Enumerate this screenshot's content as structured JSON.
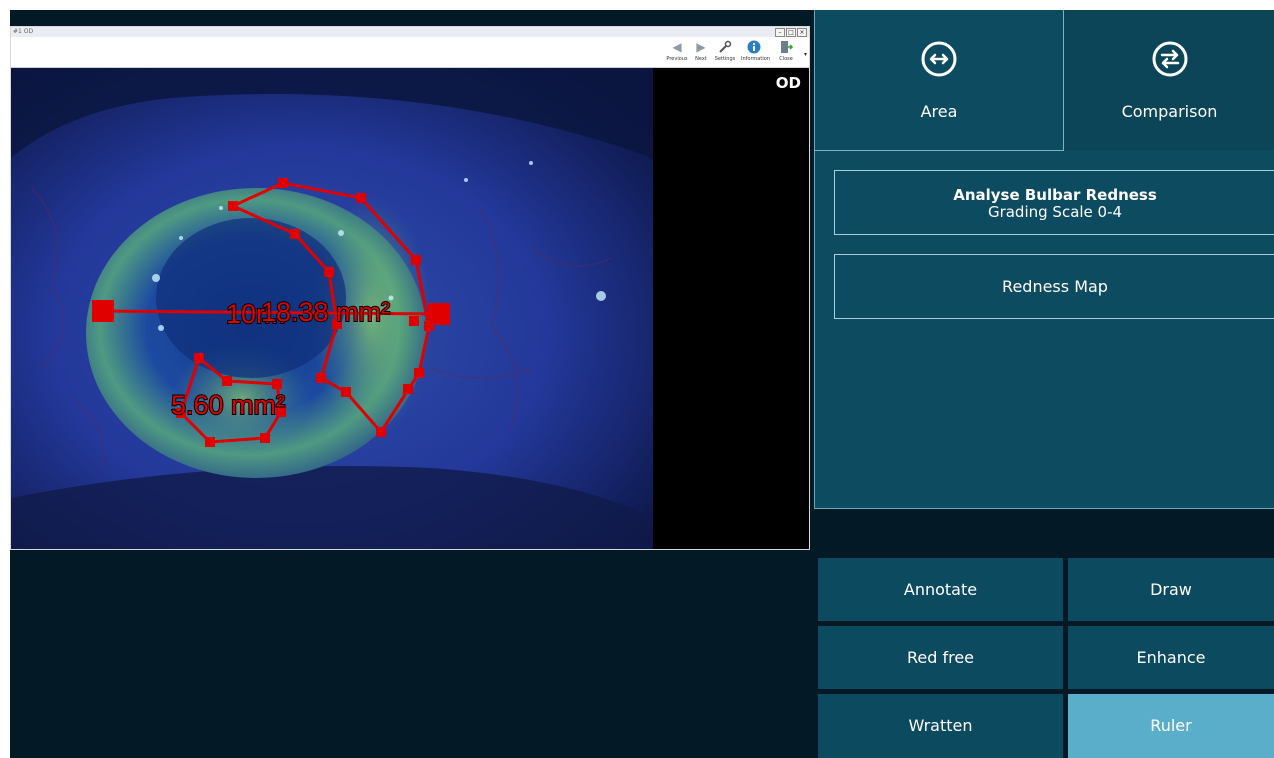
{
  "viewer": {
    "title": "#1 OD",
    "window_buttons": [
      "–",
      "□",
      "×"
    ],
    "toolbar": [
      {
        "label": "Previous",
        "icon": "left-arrow-icon"
      },
      {
        "label": "Next",
        "icon": "right-arrow-icon"
      },
      {
        "label": "Settings",
        "icon": "wrench-icon"
      },
      {
        "label": "Information",
        "icon": "info-icon"
      },
      {
        "label": "Close",
        "icon": "exit-icon"
      }
    ],
    "toolbar_dropdown": "▾",
    "eye_label": "OD",
    "measurements": {
      "ruler_label": "10r...",
      "area_large": "18.38 mm²",
      "area_small": "5.60 mm²"
    }
  },
  "panel": {
    "tabs": [
      {
        "label": "Area",
        "icon": "horizontal-arrows-icon"
      },
      {
        "label": "Comparison",
        "icon": "swap-arrows-icon"
      }
    ],
    "analyse": {
      "title": "Analyse Bulbar Redness",
      "subtitle": "Grading Scale 0-4"
    },
    "redness_map": "Redness Map"
  },
  "tools": [
    {
      "label": "Annotate",
      "active": false
    },
    {
      "label": "Draw",
      "active": false
    },
    {
      "label": "Red free",
      "active": false
    },
    {
      "label": "Enhance",
      "active": false
    },
    {
      "label": "Wratten",
      "active": false
    },
    {
      "label": "Ruler",
      "active": true
    }
  ],
  "colors": {
    "app_bg": "#031a26",
    "panel_bg": "#0d4b60",
    "active_tool": "#5aaec9",
    "annotation_red": "#e00000"
  }
}
